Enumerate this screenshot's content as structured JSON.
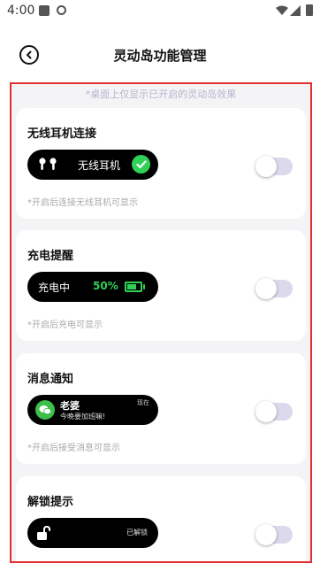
{
  "status_bar": {
    "time": "4:00"
  },
  "header": {
    "title": "灵动岛功能管理"
  },
  "tip": "*桌面上仅显示已开启的灵动岛效果",
  "cards": [
    {
      "title": "无线耳机连接",
      "pill_label": "无线耳机",
      "hint": "*开启后连接无线耳机可显示",
      "toggle_on": false
    },
    {
      "title": "充电提醒",
      "pill_label": "充电中",
      "battery_percent": "50%",
      "hint": "*开启后充电可显示",
      "toggle_on": false
    },
    {
      "title": "消息通知",
      "sender": "老婆",
      "message": "今晚要加班嘛!",
      "time": "现在",
      "hint": "*开启后接受消息可显示",
      "toggle_on": false
    },
    {
      "title": "解锁提示",
      "pill_label": "已解锁",
      "toggle_on": false
    }
  ],
  "colors": {
    "accent_green": "#2fd157",
    "toggle_off_track": "#dcd9ec",
    "highlight_border": "#e23030",
    "tip_text": "#b9b3cf"
  }
}
